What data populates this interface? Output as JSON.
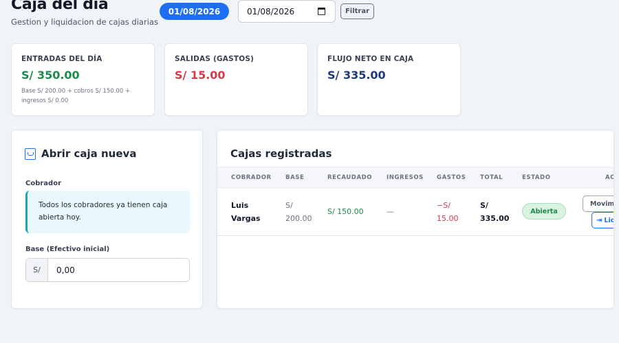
{
  "header": {
    "title": "Caja del día",
    "subtitle": "Gestion y liquidacion de cajas diarias",
    "date_badge": "01/08/2026",
    "date_input_value": "01/08/2026",
    "filter_label": "Filtrar"
  },
  "stats": [
    {
      "label": "ENTRADAS DEL DÍA",
      "value": "S/ 350.00",
      "note": "Base S/ 200.00 + cobros S/ 150.00 + ingresos S/ 0.00"
    },
    {
      "label": "SALIDAS (GASTOS)",
      "value": "S/ 15.00"
    },
    {
      "label": "FLUJO NETO EN CAJA",
      "value": "S/ 335.00"
    }
  ],
  "open_box": {
    "title": "Abrir caja nueva",
    "icon": "cash-box-icon",
    "cobrador_label": "Cobrador",
    "info_message": "Todos los cobradores ya tienen caja abierta hoy.",
    "base_label": "Base (Efectivo inicial)",
    "currency_prefix": "S/",
    "base_value": "0,00"
  },
  "registered": {
    "title": "Cajas registradas",
    "columns": [
      "COBRADOR",
      "BASE",
      "RECAUDADO",
      "INGRESOS",
      "GASTOS",
      "TOTAL",
      "ESTADO",
      "ACCIONES"
    ],
    "rows": [
      {
        "cobrador_first": "Luis",
        "cobrador_last": "Vargas",
        "base_currency": "S/",
        "base_amount": "200.00",
        "recaudado": "S/ 150.00",
        "ingresos": "—",
        "gastos_currency": "−S/",
        "gastos_amount": "15.00",
        "total_currency": "S/",
        "total_amount": "335.00",
        "estado": "Abierta",
        "movimientos_label": "Movimientos",
        "liquidar_label": "Liquidar"
      }
    ]
  },
  "colors": {
    "accent": "#1d6ef5",
    "positive": "#1c8a4a",
    "negative": "#d63a48",
    "neutral_dark": "#1e3a78"
  }
}
